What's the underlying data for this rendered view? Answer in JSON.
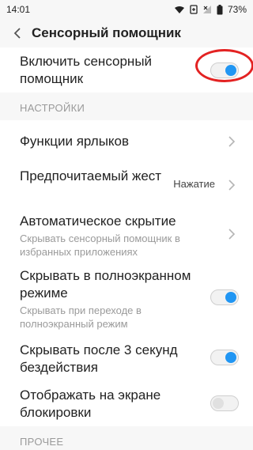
{
  "status_bar": {
    "time": "14:01",
    "battery": "73%"
  },
  "header": {
    "title": "Сенсорный помощник"
  },
  "main_toggle": {
    "label": "Включить сенсорный помощник",
    "state": "on"
  },
  "sections": {
    "settings_label": "НАСТРОЙКИ",
    "other_label": "ПРОЧЕЕ"
  },
  "settings": {
    "shortcuts": {
      "title": "Функции ярлыков"
    },
    "gesture": {
      "title": "Предпочитаемый жест",
      "value": "Нажатие"
    },
    "autohide": {
      "title": "Автоматическое скрытие",
      "subtitle": "Скрывать сенсорный помощник в избранных приложениях"
    },
    "fullscreen": {
      "title": "Скрывать в полноэкранном режиме",
      "subtitle": "Скрывать при переходе в полноэкранный режим",
      "state": "on"
    },
    "idle": {
      "title": "Скрывать после 3 секунд бездействия",
      "state": "on"
    },
    "lockscreen": {
      "title": "Отображать на экране блокировки",
      "state": "off"
    }
  },
  "colors": {
    "accent": "#2196f3",
    "highlight": "#e32222"
  }
}
